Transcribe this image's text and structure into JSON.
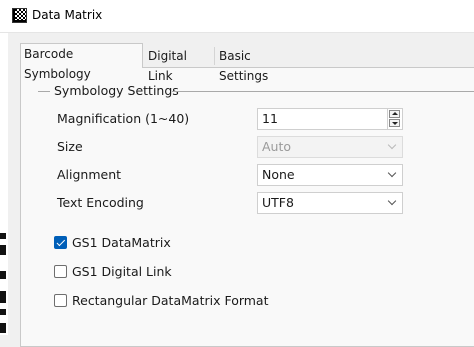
{
  "window": {
    "title": "Data Matrix",
    "icon": "datamatrix-icon"
  },
  "tabs": [
    {
      "label": "Barcode Symbology",
      "active": true
    },
    {
      "label": "Digital Link",
      "active": false
    },
    {
      "label": "Basic Settings",
      "active": false
    }
  ],
  "group": {
    "title": "Symbology Settings"
  },
  "fields": {
    "magnification": {
      "label": "Magnification (1~40)",
      "value": "11"
    },
    "size": {
      "label": "Size",
      "value": "Auto",
      "disabled": true
    },
    "alignment": {
      "label": "Alignment",
      "value": "None"
    },
    "text_encoding": {
      "label": "Text Encoding",
      "value": "UTF8"
    }
  },
  "checkboxes": [
    {
      "label": "GS1 DataMatrix",
      "checked": true
    },
    {
      "label": "GS1 Digital Link",
      "checked": false
    },
    {
      "label": "Rectangular DataMatrix Format",
      "checked": false
    }
  ],
  "colors": {
    "accent": "#005fb8",
    "panel": "#f9f9f9",
    "background": "#f0f0f0"
  }
}
